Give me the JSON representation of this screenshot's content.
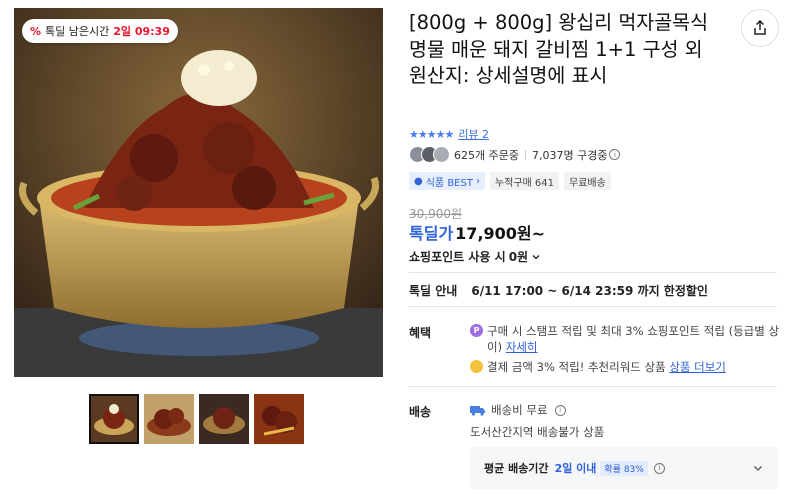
{
  "product": {
    "title": "[800g + 800g] 왕십리 먹자골목식 명물 매운 돼지 갈비찜 1+1 구성 외 원산지: 상세설명에 표시",
    "image_alt": "매운 돼지 갈비찜 냄비"
  },
  "timer": {
    "icon": "percent-icon",
    "label": "톡딜 남은시간",
    "value": "2일 09:39"
  },
  "thumbnails": {
    "count": 4,
    "selected_index": 0
  },
  "rating": {
    "stars": 5,
    "review_link": "리뷰 2"
  },
  "stats": {
    "orders": "625개 주문중",
    "subscribers": "7,037명 구경중"
  },
  "badges": {
    "best": "식품 BEST",
    "cumulative": "누적구매 641",
    "free_shipping": "무료배송"
  },
  "price": {
    "original": "30,900원",
    "deal_label": "톡딜가",
    "amount": "17,900원~"
  },
  "points": {
    "label": "쇼핑포인트 사용 시",
    "amount": "0원"
  },
  "deal_info": {
    "label": "톡딜 안내",
    "value": "6/11 17:00 ~ 6/14 23:59 까지 한정할인"
  },
  "benefits": {
    "label": "혜택",
    "item1_text": "구매 시 스탬프 적립 및 최대 3% 쇼핑포인트 적립 (등급별 상이)",
    "item1_link": "자세히",
    "item2_text": "결제 금액 3% 적립! 추천리워드 상품",
    "item2_link": "상품 더보기"
  },
  "shipping": {
    "label": "배송",
    "fee": "배송비 무료",
    "restriction": "도서산간지역 배송불가 상품",
    "avg_label": "평균 배송기간",
    "avg_value": "2일 이내",
    "probability": "확률 83%"
  },
  "colors": {
    "accent_blue": "#2f62d6",
    "deal_red": "#e8162f"
  }
}
